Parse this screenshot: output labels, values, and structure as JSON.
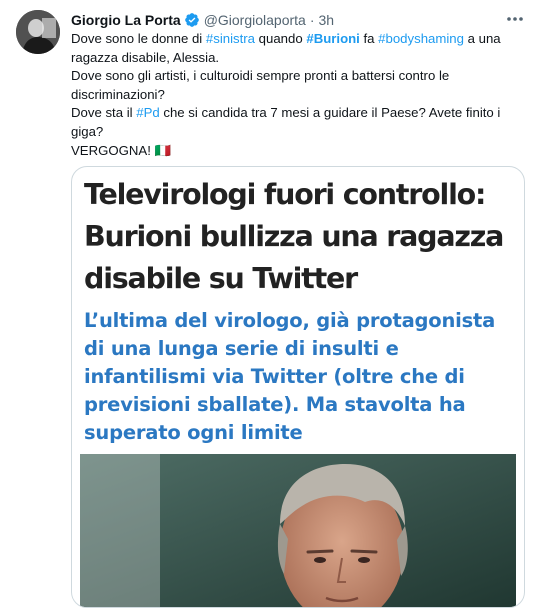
{
  "tweet": {
    "author_name": "Giorgio La Porta",
    "handle": "@Giorgiolaporta",
    "separator": "·",
    "time": "3h",
    "more_label": "···",
    "text": {
      "l1_a": "Dove sono le donne di ",
      "l1_tag_sinistra": "#sinistra",
      "l1_b": " quando ",
      "l1_tag_burioni": "#Burioni",
      "l1_c": " fa ",
      "l1_tag_bodyshaming": "#bodyshaming",
      "l1_d": " a una",
      "l2": "ragazza disabile, Alessia.",
      "l3": "Dove sono gli artisti, i culturoidi sempre pronti a battersi contro le",
      "l4": "discriminazioni?",
      "l5_a": "Dove sta il ",
      "l5_tag_pd": "#Pd",
      "l5_b": " che si candida tra 7 mesi a guidare il Paese? Avete finito i",
      "l6": "giga?",
      "l7": "VERGOGNA! 🇮🇹"
    }
  },
  "card": {
    "headline_lines": [
      "Televirologi fuori controllo:",
      "Burioni bullizza una ragazza",
      "disabile su Twitter"
    ],
    "subhead_lines": [
      "L’ultima del virologo, già protagonista",
      "di una lunga serie di insulti e",
      "infantilismi via Twitter (oltre che di",
      "previsioni sballate). Ma stavolta ha",
      "superato ogni limite"
    ]
  },
  "icons": {
    "verified": "verified-badge-icon",
    "more": "more-options-icon"
  },
  "colors": {
    "link": "#1d9bf0",
    "subhead": "#2b78c2",
    "headline": "#222222",
    "secondary_text": "#536471",
    "border": "#cfd9de"
  }
}
